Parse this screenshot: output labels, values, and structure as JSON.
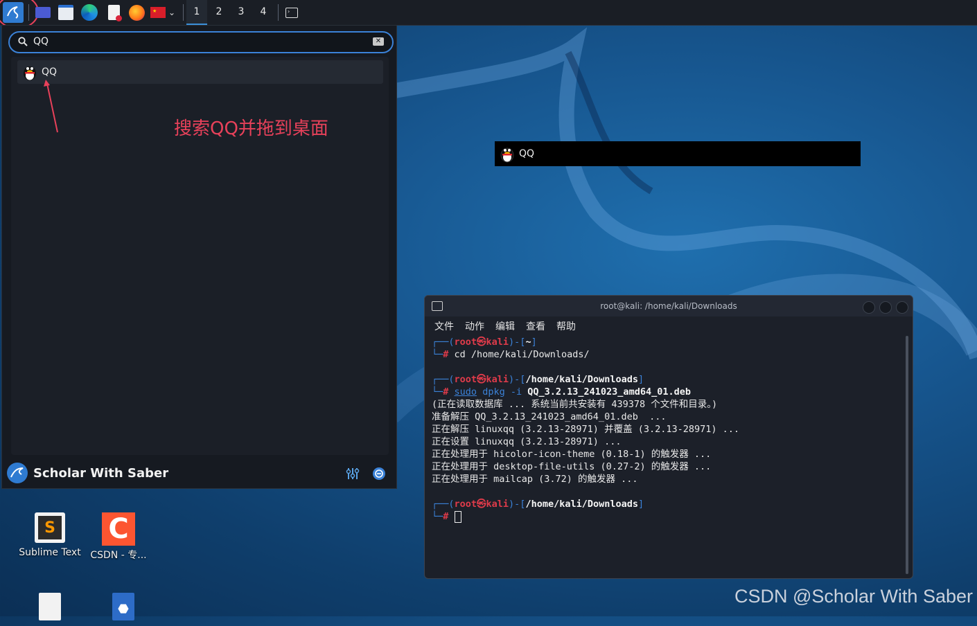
{
  "panel": {
    "workspaces": [
      "1",
      "2",
      "3",
      "4"
    ],
    "active_workspace": "1",
    "launcher_icons": [
      "kali-menu-icon",
      "show-desktop-icon",
      "file-manager-icon",
      "edge-browser-icon",
      "text-editor-icon",
      "firefox-icon",
      "flag-icon",
      "dropdown-chevron-icon",
      "terminal-icon"
    ]
  },
  "menu": {
    "search_value": "QQ",
    "results": [
      {
        "label": "QQ",
        "icon": "qq-penguin-icon"
      }
    ],
    "annotation": "搜索QQ并拖到桌面",
    "user_name": "Scholar With Saber"
  },
  "drag_ghost": {
    "label": "QQ"
  },
  "terminal": {
    "title": "root@kali: /home/kali/Downloads",
    "menu": [
      "文件",
      "动作",
      "编辑",
      "查看",
      "帮助"
    ],
    "lines": {
      "p1_user": "root",
      "p1_host": "kali",
      "p1_path": "~",
      "cmd1": "cd /home/kali/Downloads/",
      "p2_path": "/home/kali/Downloads",
      "cmd2_sudo": "sudo",
      "cmd2_dpkg": "dpkg",
      "cmd2_flag": "-i",
      "cmd2_arg": "QQ_3.2.13_241023_amd64_01.deb",
      "out1": "(正在读取数据库 ... 系统当前共安装有 439378 个文件和目录。)",
      "out2": "准备解压 QQ_3.2.13_241023_amd64_01.deb  ...",
      "out3": "正在解压 linuxqq (3.2.13-28971) 并覆盖 (3.2.13-28971) ...",
      "out4": "正在设置 linuxqq (3.2.13-28971) ...",
      "out5": "正在处理用于 hicolor-icon-theme (0.18-1) 的触发器 ...",
      "out6": "正在处理用于 desktop-file-utils (0.27-2) 的触发器 ...",
      "out7": "正在处理用于 mailcap (3.72) 的触发器 ...",
      "p3_path": "/home/kali/Downloads"
    }
  },
  "desktop": {
    "icons": [
      {
        "label": "Sublime Text",
        "icon": "sublime-text-icon"
      },
      {
        "label": "CSDN - 专...",
        "icon": "csdn-icon"
      }
    ],
    "watermark": "CSDN @Scholar With Saber"
  },
  "colors": {
    "accent": "#3b82d8",
    "annotation": "#e8415a",
    "prompt_red": "#e03b4a"
  }
}
